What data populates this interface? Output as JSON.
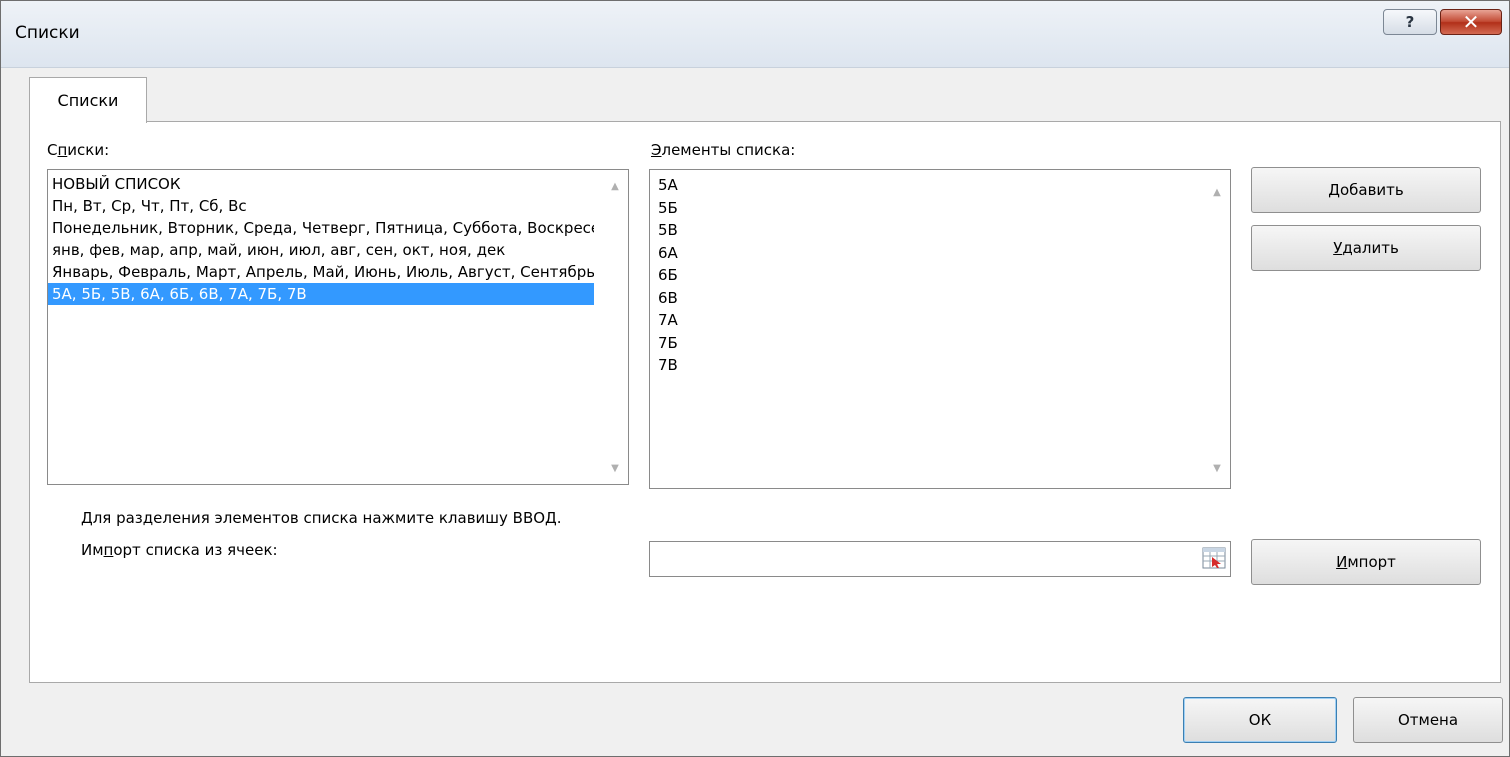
{
  "window": {
    "title": "Списки",
    "help_label": "?",
    "close_label": "✕"
  },
  "tab": {
    "label": "Списки"
  },
  "lists": {
    "label_prefix": "С",
    "label_mnemonic": "п",
    "label_suffix": "иски:",
    "items": [
      "НОВЫЙ СПИСОК",
      "Пн, Вт, Ср, Чт, Пт, Сб, Вс",
      "Понедельник, Вторник, Среда, Четверг, Пятница, Суббота, Воскресенье",
      "янв, фев, мар, апр, май, июн, июл, авг, сен, окт, ноя, дек",
      "Январь, Февраль, Март, Апрель, Май, Июнь, Июль, Август, Сентябрь, Октябрь, Ноябрь, Декабрь",
      "5А, 5Б, 5В, 6А, 6Б, 6В, 7А, 7Б, 7В"
    ],
    "selected_index": 5
  },
  "entries": {
    "label_mnemonic": "Э",
    "label_suffix": "лементы списка:",
    "items": [
      "5А",
      "5Б",
      "5В",
      "6А",
      "6Б",
      "6В",
      "7А",
      "7Б",
      "7В"
    ]
  },
  "buttons": {
    "add_mnemonic": "Д",
    "add_suffix": "обавить",
    "delete_mnemonic": "У",
    "delete_suffix": "далить",
    "import_mnemonic": "И",
    "import_suffix": "мпорт",
    "ok_label": "ОК",
    "cancel_label": "Отмена"
  },
  "hint": "Для разделения элементов списка нажмите клавишу ВВОД.",
  "import_source": {
    "label_prefix": "Им",
    "label_mnemonic": "п",
    "label_suffix": "орт списка из ячеек:",
    "value": ""
  }
}
